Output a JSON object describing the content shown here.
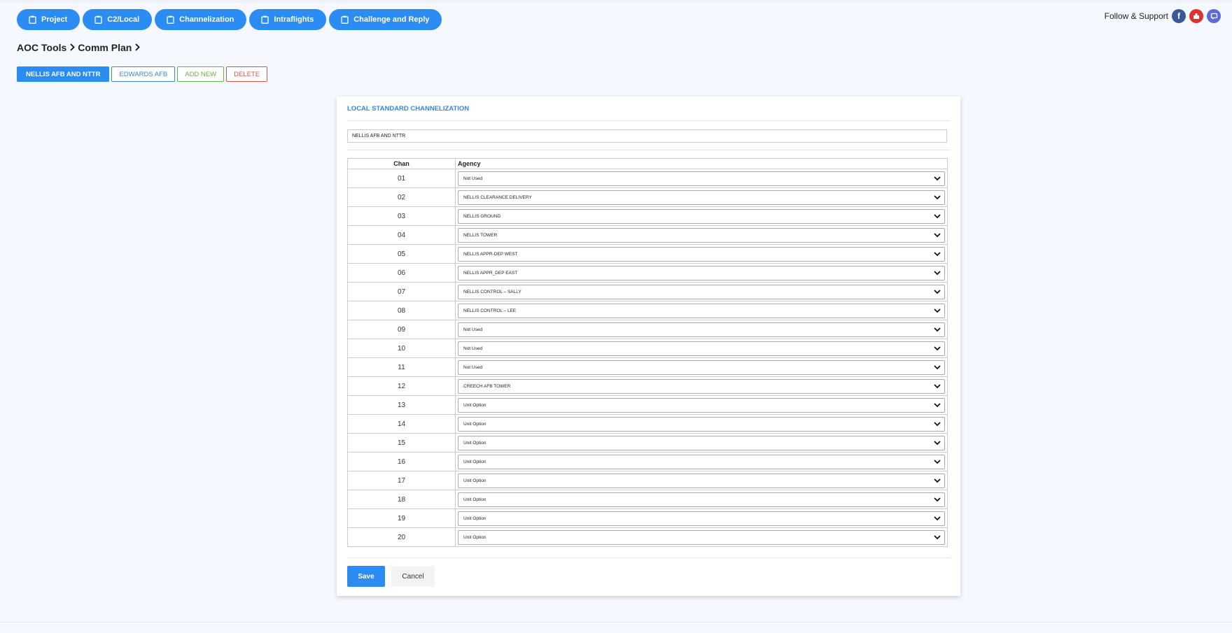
{
  "nav": {
    "tabs": [
      {
        "label": "Project",
        "icon": "clipboard-icon"
      },
      {
        "label": "C2/Local",
        "icon": "clipboard-icon"
      },
      {
        "label": "Channelization",
        "icon": "clipboard-icon"
      },
      {
        "label": "Intraflights",
        "icon": "clipboard-icon"
      },
      {
        "label": "Challenge and Reply",
        "icon": "clipboard-icon"
      }
    ]
  },
  "follow": {
    "label": "Follow & Support",
    "icons": [
      "facebook-icon",
      "youtube-icon",
      "chat-icon"
    ]
  },
  "breadcrumb": {
    "items": [
      "AOC Tools",
      "Comm Plan"
    ]
  },
  "actions": {
    "nellis": "NELLIS AFB AND NTTR",
    "edwards": "EDWARDS AFB",
    "add_new": "ADD NEW",
    "delete": "DELETE"
  },
  "card": {
    "title": "LOCAL STANDARD CHANNELIZATION",
    "name_value": "NELLIS AFB AND NTTR",
    "col_chan": "Chan",
    "col_agency": "Agency",
    "rows": [
      {
        "chan": "01",
        "agency": "Not Used"
      },
      {
        "chan": "02",
        "agency": "NELLIS CLEARANCE DELIVERY"
      },
      {
        "chan": "03",
        "agency": "NELLIS GROUND"
      },
      {
        "chan": "04",
        "agency": "NELLIS TOWER"
      },
      {
        "chan": "05",
        "agency": "NELLIS APPR-DEP WEST"
      },
      {
        "chan": "06",
        "agency": "NELLIS APPR_DEP EAST"
      },
      {
        "chan": "07",
        "agency": "NELLIS CONTROL – SALLY"
      },
      {
        "chan": "08",
        "agency": "NELLIS CONTROL – LEE"
      },
      {
        "chan": "09",
        "agency": "Not Used"
      },
      {
        "chan": "10",
        "agency": "Not Used"
      },
      {
        "chan": "11",
        "agency": "Not Used"
      },
      {
        "chan": "12",
        "agency": "CREECH AFB TOWER"
      },
      {
        "chan": "13",
        "agency": "Unit Option"
      },
      {
        "chan": "14",
        "agency": "Unit Option"
      },
      {
        "chan": "15",
        "agency": "Unit Option"
      },
      {
        "chan": "16",
        "agency": "Unit Option"
      },
      {
        "chan": "17",
        "agency": "Unit Option"
      },
      {
        "chan": "18",
        "agency": "Unit Option"
      },
      {
        "chan": "19",
        "agency": "Unit Option"
      },
      {
        "chan": "20",
        "agency": "Unit Option"
      }
    ],
    "save": "Save",
    "cancel": "Cancel"
  },
  "colors": {
    "accent": "#2b8cf3",
    "title_blue": "#3a86d6",
    "add_green": "#6cb33f",
    "delete_red": "#d9534f"
  }
}
